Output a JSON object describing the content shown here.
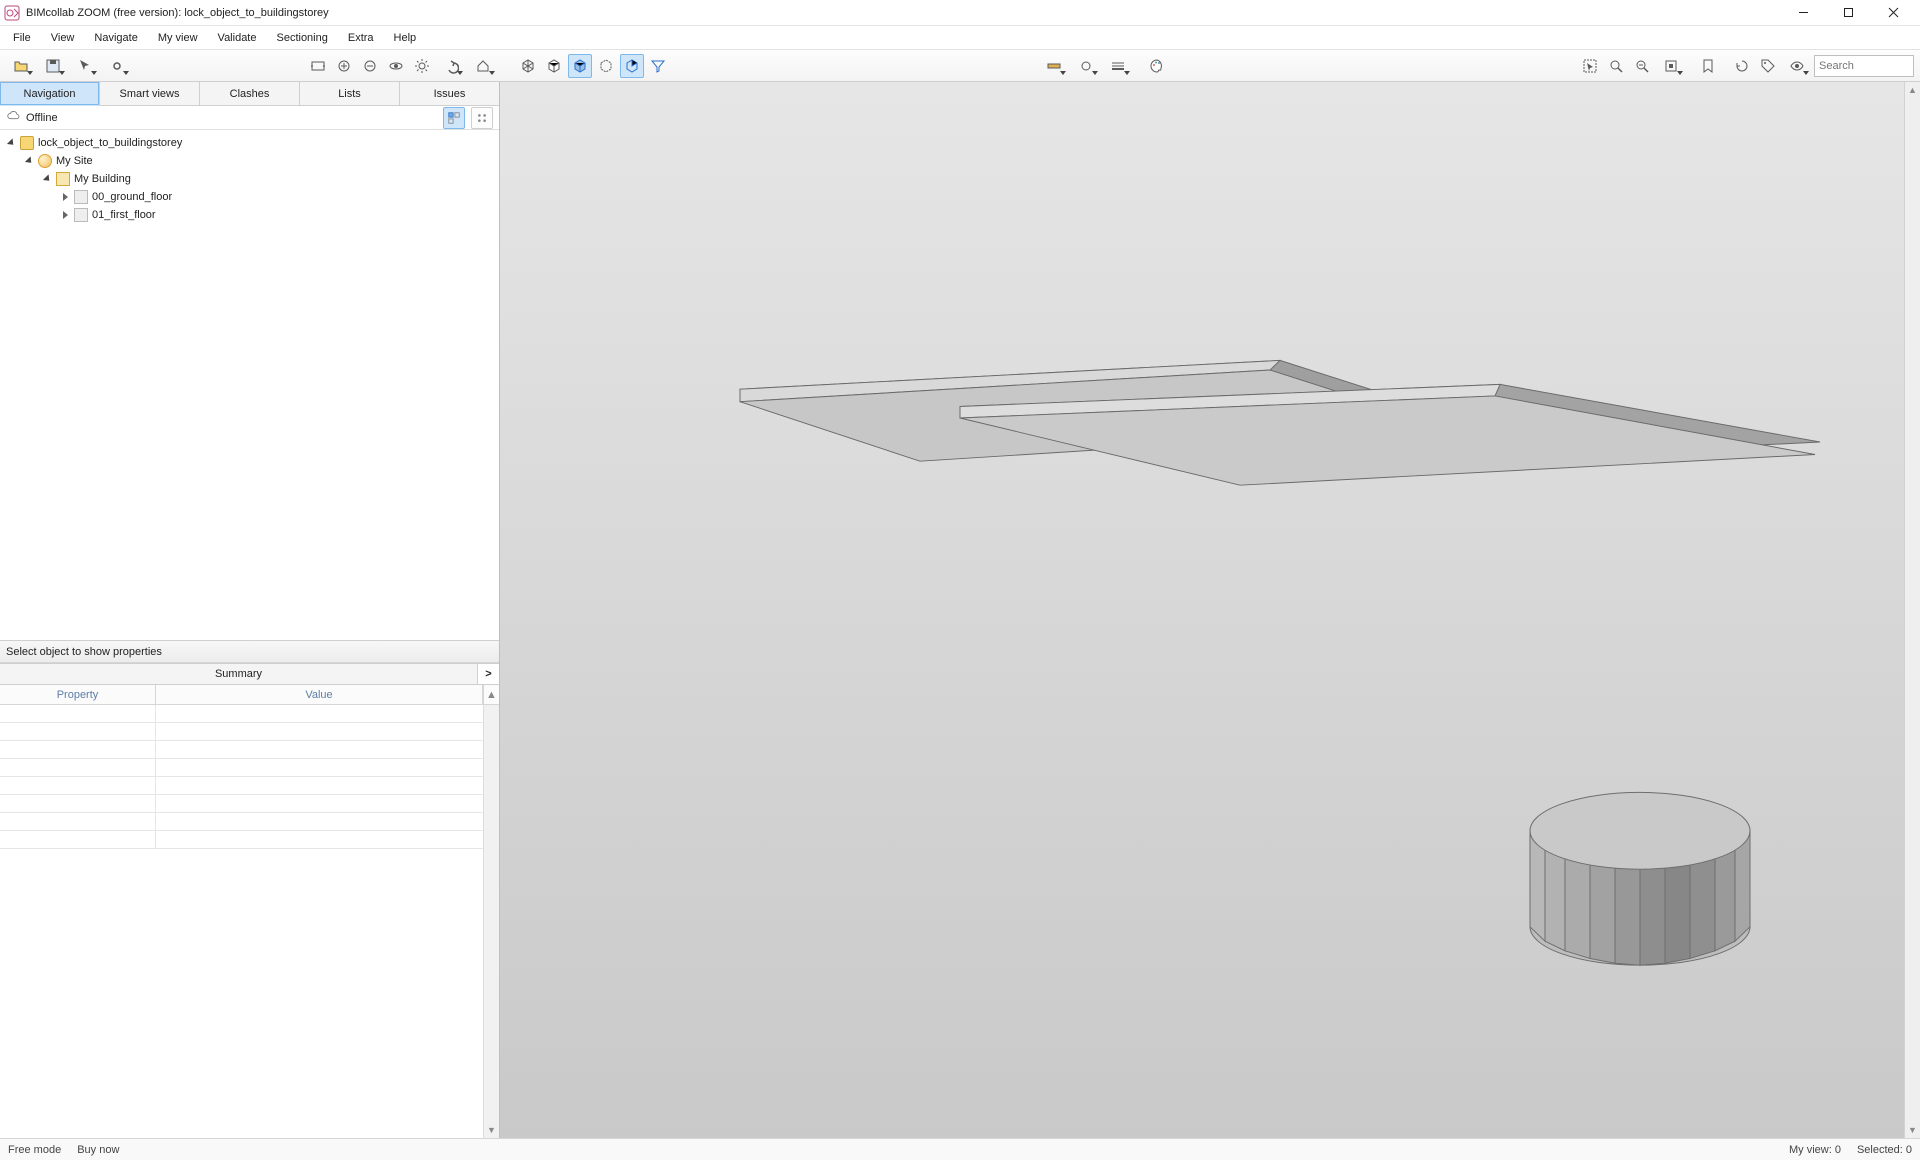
{
  "title": "BIMcollab ZOOM (free version): lock_object_to_buildingstorey",
  "menu": [
    "File",
    "View",
    "Navigate",
    "My view",
    "Validate",
    "Sectioning",
    "Extra",
    "Help"
  ],
  "search_placeholder": "Search",
  "side": {
    "tabs": [
      "Navigation",
      "Smart views",
      "Clashes",
      "Lists",
      "Issues"
    ],
    "active_tab": 0,
    "status": "Offline",
    "tree": {
      "root": "lock_object_to_buildingstorey",
      "site": "My Site",
      "building": "My Building",
      "storeys": [
        "00_ground_floor",
        "01_first_floor"
      ]
    }
  },
  "props": {
    "header": "Select object to show properties",
    "tab": "Summary",
    "col_property": "Property",
    "col_value": "Value"
  },
  "statusbar": {
    "mode": "Free mode",
    "buy": "Buy now",
    "myview": "My view: 0",
    "selected": "Selected: 0"
  }
}
